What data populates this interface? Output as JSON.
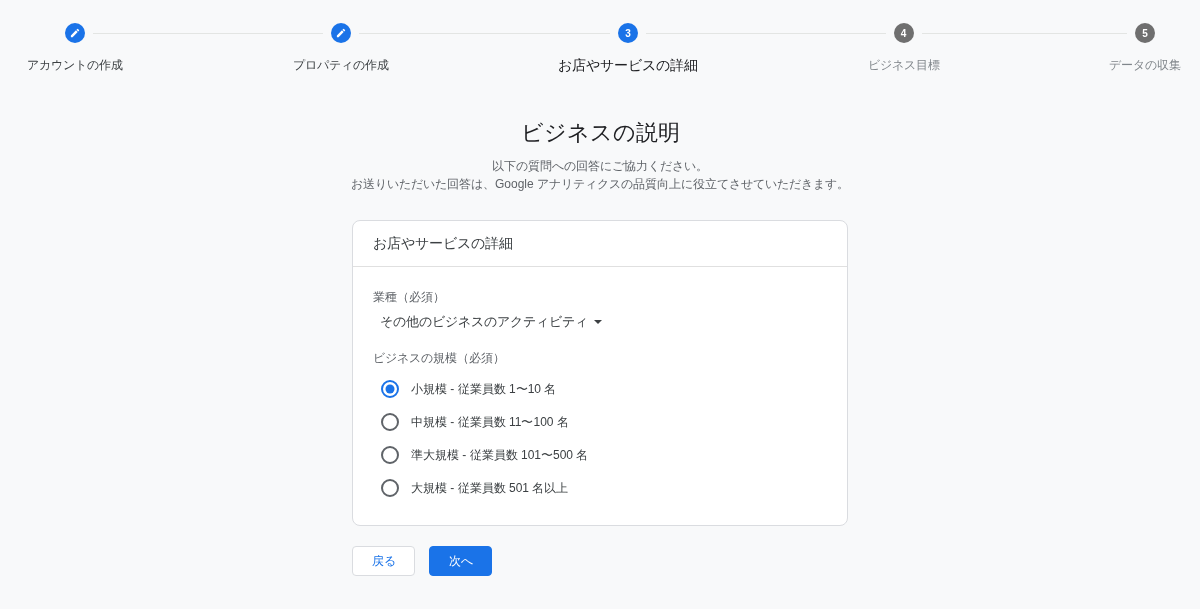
{
  "steps": [
    {
      "label": "アカウントの作成",
      "completed": true,
      "selected": false
    },
    {
      "label": "プロパティの作成",
      "completed": true,
      "selected": false
    },
    {
      "number": "3",
      "label": "お店やサービスの詳細",
      "completed": false,
      "selected": true
    },
    {
      "number": "4",
      "label": "ビジネス目標",
      "completed": false,
      "selected": false
    },
    {
      "number": "5",
      "label": "データの収集",
      "completed": false,
      "selected": false
    }
  ],
  "heading": {
    "title": "ビジネスの説明",
    "description": [
      "以下の質問への回答にご協力ください。",
      "お送りいただいた回答は、Google アナリティクスの品質向上に役立てさせていただきます。"
    ]
  },
  "card": {
    "title": "お店やサービスの詳細",
    "industry": {
      "label": "業種（必須）",
      "value": "その他のビジネスのアクティビティ"
    },
    "size": {
      "label": "ビジネスの規模（必須）",
      "options": [
        {
          "label": "小規模 - 従業員数 1〜10 名",
          "selected": true
        },
        {
          "label": "中規模 - 従業員数 11〜100 名",
          "selected": false
        },
        {
          "label": "準大規模 - 従業員数 101〜500 名",
          "selected": false
        },
        {
          "label": "大規模 - 従業員数 501 名以上",
          "selected": false
        }
      ]
    }
  },
  "buttons": [
    {
      "label": "戻る",
      "kind": "secondary"
    },
    {
      "label": "次へ",
      "kind": "primary"
    }
  ]
}
